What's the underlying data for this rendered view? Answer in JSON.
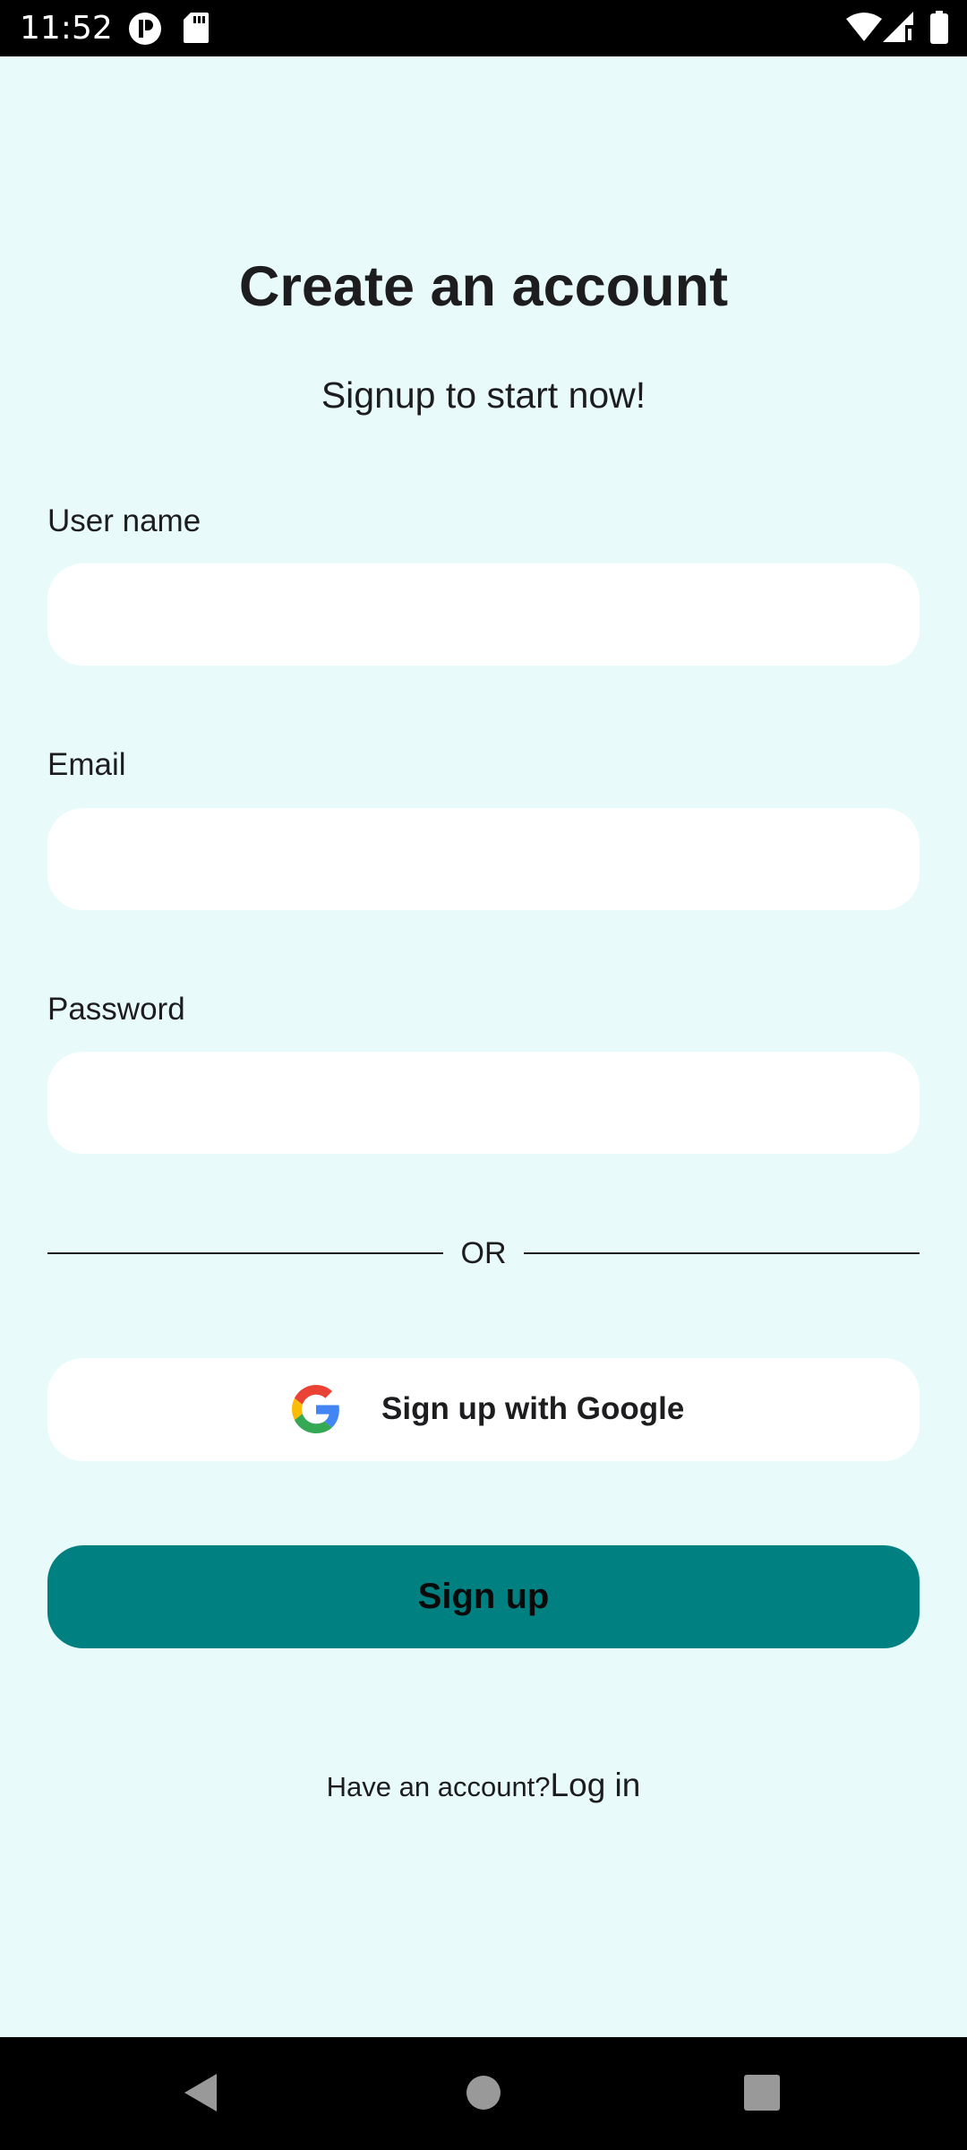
{
  "status_bar": {
    "time": "11:52",
    "icons": [
      "notification-badge-icon",
      "sd-card-icon",
      "wifi-icon",
      "cellular-signal-icon",
      "battery-icon"
    ]
  },
  "screen": {
    "title": "Create an account",
    "subtitle": "Signup to start now!"
  },
  "form": {
    "username": {
      "label": "User name",
      "value": ""
    },
    "email": {
      "label": "Email",
      "value": ""
    },
    "password": {
      "label": "Password",
      "value": ""
    }
  },
  "divider": {
    "text": "OR"
  },
  "google_button": {
    "label": "Sign up with Google",
    "icon": "google-icon"
  },
  "signup_button": {
    "label": "Sign up",
    "color": "#008080"
  },
  "footer": {
    "prompt": "Have an account?",
    "link": "Log in"
  },
  "nav_bar": {
    "icons": [
      "back-icon",
      "home-icon",
      "recents-icon"
    ]
  },
  "colors": {
    "background": "#e8fbfa",
    "accent": "#008080",
    "field": "#ffffff"
  }
}
